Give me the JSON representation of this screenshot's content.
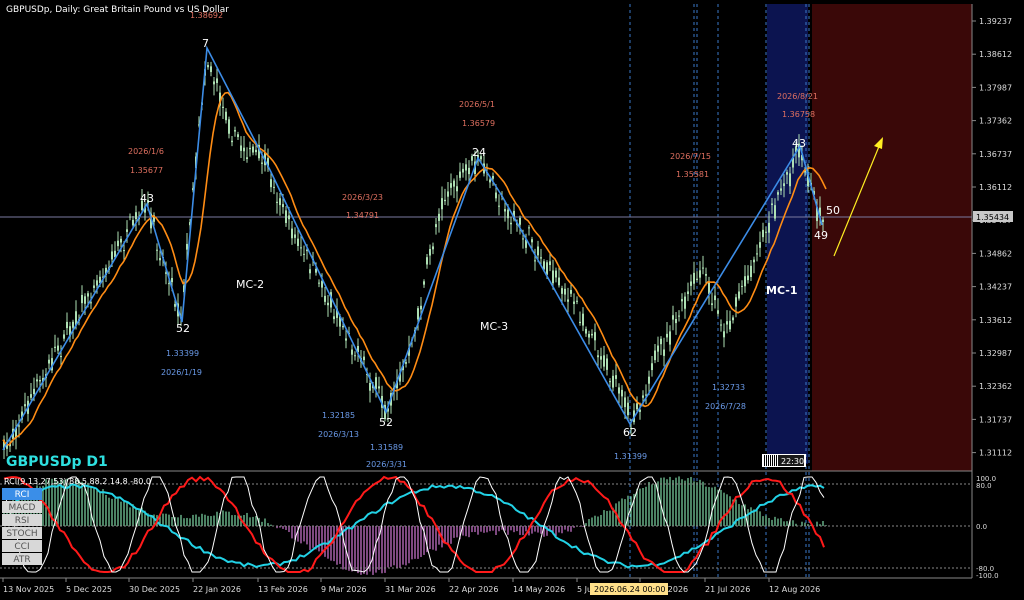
{
  "header": {
    "title": "GBPUSDp, Daily:  Great Britain Pound vs US Dollar"
  },
  "symbol_label": "GBPUSDp D1",
  "current_price": "1.35434",
  "countdown": "22:30",
  "price_axis": [
    "1.39237",
    "1.38612",
    "1.37987",
    "1.37362",
    "1.36737",
    "1.36112",
    "1.35487",
    "1.34862",
    "1.34237",
    "1.33612",
    "1.32987",
    "1.32362",
    "1.31737",
    "1.31112"
  ],
  "time_axis": [
    "13 Nov 2025",
    "5 Dec 2025",
    "30 Dec 2025",
    "22 Jan 2026",
    "13 Feb 2026",
    "9 Mar 2026",
    "31 Mar 2026",
    "22 Apr 2026",
    "14 May 2026",
    "5 Jun 2026",
    "24 Jun 2026",
    "21 Jul 2026",
    "12 Aug 2026"
  ],
  "crosshair_time": "2026.06.24 00:00",
  "waves": {
    "labels": [
      "43",
      "52",
      "7",
      "52",
      "24",
      "62",
      "43",
      "49",
      "50"
    ],
    "cycles": [
      "MC-2",
      "MC-3",
      "MC-1"
    ]
  },
  "annotations": {
    "top": [
      {
        "date": "2026/1/6",
        "price": "1.35677"
      },
      {
        "date": "",
        "price": "1.38692"
      },
      {
        "date": "2026/3/23",
        "price": "1.34791"
      },
      {
        "date": "2026/5/1",
        "price": "1.36579"
      },
      {
        "date": "2026/7/15",
        "price": "1.35581"
      },
      {
        "date": "2026/8/21",
        "price": "1.36758"
      }
    ],
    "bottom": [
      {
        "price": "1.33399",
        "date": "2026/1/19"
      },
      {
        "price": "1.32185",
        "date": "2026/3/13"
      },
      {
        "price": "1.31589",
        "date": "2026/3/31"
      },
      {
        "price": "1.31399",
        "date": ""
      },
      {
        "price": "1.32733",
        "date": "2026/7/28"
      }
    ]
  },
  "indicator": {
    "title": "RCI(9,13,27,53) 88.5 88.2 14.8 -80.0",
    "buttons": [
      "RCI",
      "MACD",
      "RSI",
      "STOCH",
      "CCI",
      "ATR"
    ],
    "active_button": "RCI",
    "axis": [
      "100.0",
      "80.0",
      "0.0",
      "-80.0",
      "-100.0"
    ]
  },
  "colors": {
    "background": "#000000",
    "candle": "#aee0b4",
    "wave_line": "#3c8ce6",
    "moving_average": "#ff8c14",
    "annotation_top": "#e07060",
    "annotation_bottom": "#6a9ae8",
    "highlight_band": "#0c1450",
    "future_zone": "#3a0808",
    "arrow": "#ffee22",
    "rci_fast": "#ffffff",
    "rci_mid": "#ff1a1a",
    "rci_slow": "#22d2e6",
    "histogram_pos": "#7ed9a6",
    "histogram_neg": "#d27ad6",
    "symbol_label": "#2ee0e0"
  }
}
